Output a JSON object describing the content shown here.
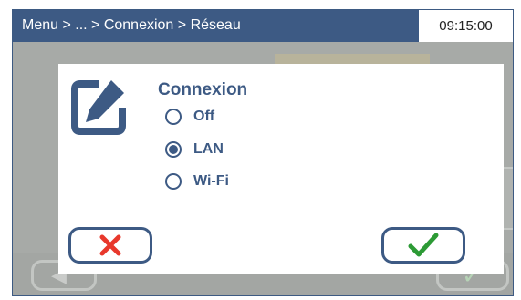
{
  "header": {
    "breadcrumb": "Menu > ... > Connexion > Réseau",
    "time": "09:15:00"
  },
  "dialog": {
    "title": "Connexion",
    "options": [
      {
        "label": "Off",
        "selected": false
      },
      {
        "label": "LAN",
        "selected": true
      },
      {
        "label": "Wi-Fi",
        "selected": false
      }
    ],
    "cancel_icon": "x-icon",
    "confirm_icon": "check-icon"
  },
  "colors": {
    "primary": "#3d5a84",
    "cancel": "#e8382c",
    "confirm": "#2c9a35",
    "overlay": "#a7aaa7"
  }
}
